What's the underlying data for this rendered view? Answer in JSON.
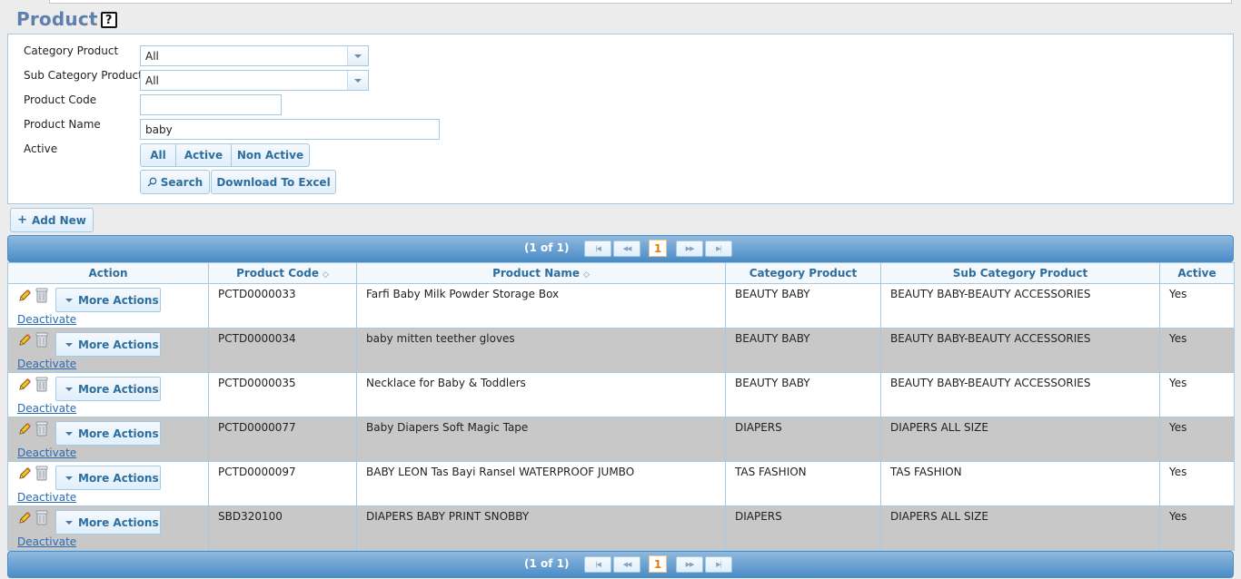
{
  "page": {
    "title": "Product",
    "help_label": "?"
  },
  "filters": {
    "category_label": "Category Product",
    "category_value": "All",
    "subcategory_label": "Sub Category Product",
    "subcategory_value": "All",
    "code_label": "Product Code",
    "code_value": "",
    "name_label": "Product Name",
    "name_value": "baby",
    "active_label": "Active",
    "active_options": [
      "All",
      "Active",
      "Non Active"
    ],
    "search_label": "Search",
    "download_label": "Download To Excel"
  },
  "add_new_label": "Add New",
  "pager": {
    "count_text": "(1 of 1)",
    "current_page": "1"
  },
  "table": {
    "headers": [
      "Action",
      "Product Code",
      "Product Name",
      "Category Product",
      "Sub Category Product",
      "Active"
    ],
    "more_actions_label": "More Actions",
    "deactivate_label": "Deactivate",
    "rows": [
      {
        "code": "PCTD0000033",
        "name": "Farfi Baby Milk Powder Storage Box",
        "category": "BEAUTY BABY",
        "subcategory": "BEAUTY BABY-BEAUTY ACCESSORIES",
        "active": "Yes"
      },
      {
        "code": "PCTD0000034",
        "name": "baby mitten teether gloves",
        "category": "BEAUTY BABY",
        "subcategory": "BEAUTY BABY-BEAUTY ACCESSORIES",
        "active": "Yes"
      },
      {
        "code": "PCTD0000035",
        "name": "Necklace for Baby & Toddlers",
        "category": "BEAUTY BABY",
        "subcategory": "BEAUTY BABY-BEAUTY ACCESSORIES",
        "active": "Yes"
      },
      {
        "code": "PCTD0000077",
        "name": "Baby Diapers Soft Magic Tape",
        "category": "DIAPERS",
        "subcategory": "DIAPERS ALL SIZE",
        "active": "Yes"
      },
      {
        "code": "PCTD0000097",
        "name": "BABY LEON Tas Bayi Ransel WATERPROOF JUMBO",
        "category": "TAS FASHION",
        "subcategory": "TAS FASHION",
        "active": "Yes"
      },
      {
        "code": "SBD320100",
        "name": "DIAPERS BABY PRINT SNOBBY",
        "category": "DIAPERS",
        "subcategory": "DIAPERS ALL SIZE",
        "active": "Yes"
      }
    ]
  },
  "colors": {
    "accent": "#2e6e9e",
    "pager": "#4a8cc7",
    "border": "#a6c9e2",
    "title": "#5d80ad"
  }
}
